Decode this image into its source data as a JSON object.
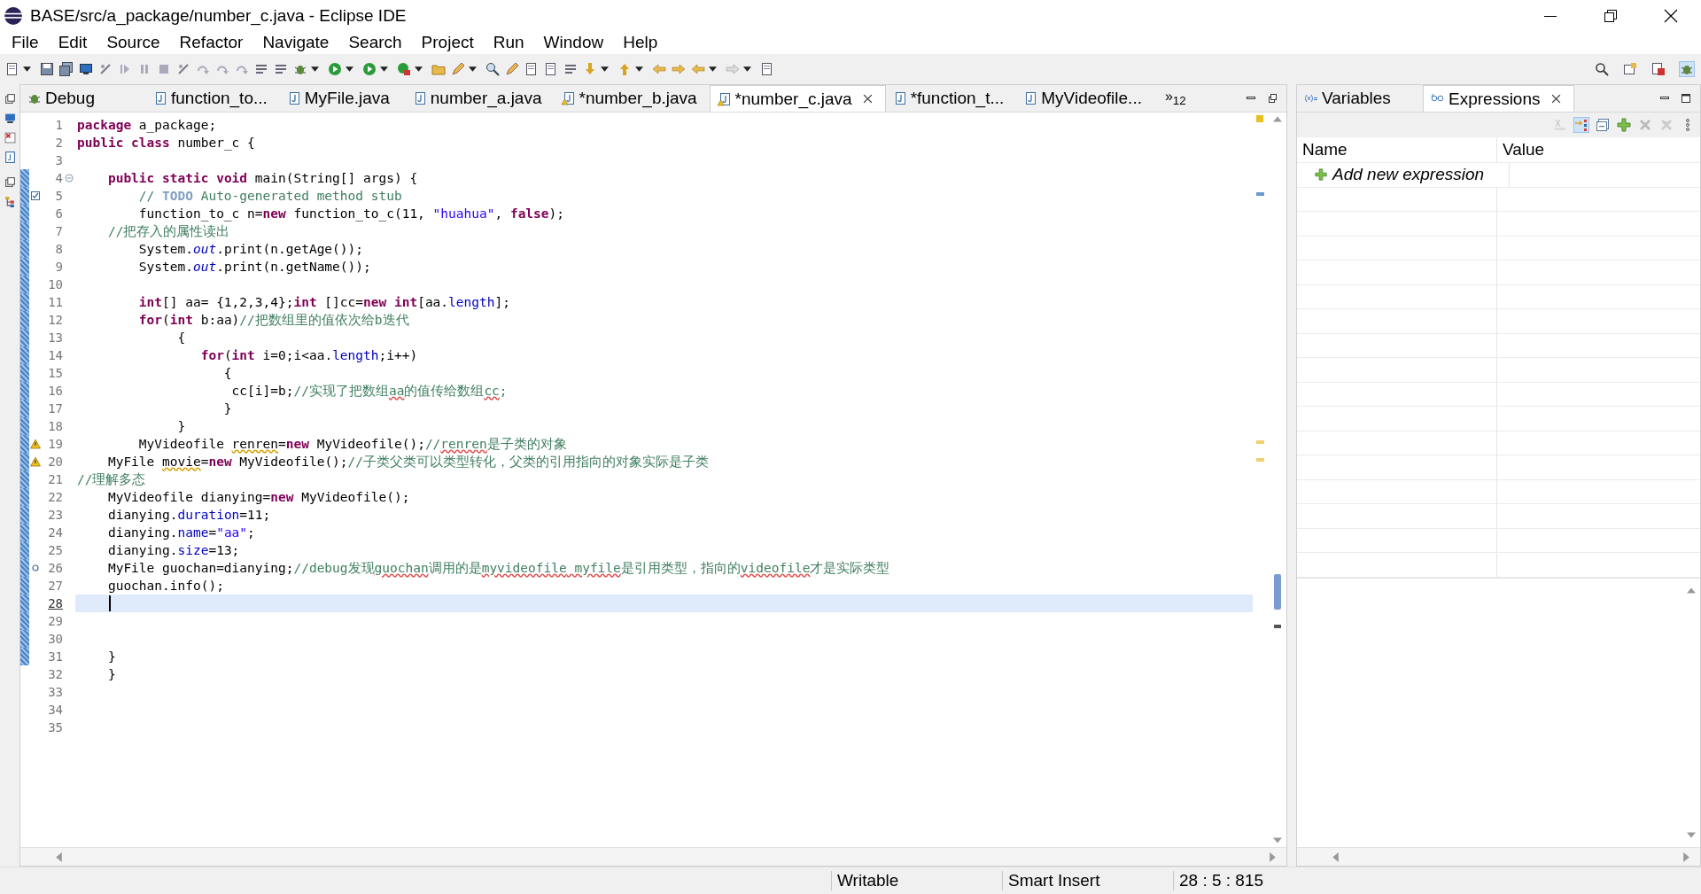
{
  "window": {
    "title": "BASE/src/a_package/number_c.java - Eclipse IDE"
  },
  "menu": [
    "File",
    "Edit",
    "Source",
    "Refactor",
    "Navigate",
    "Search",
    "Project",
    "Run",
    "Window",
    "Help"
  ],
  "editor": {
    "tabs": [
      {
        "label": "Debug",
        "kind": "debug",
        "selected": false
      },
      {
        "label": "function_to...",
        "kind": "java",
        "selected": false
      },
      {
        "label": "MyFile.java",
        "kind": "java",
        "selected": false
      },
      {
        "label": "number_a.java",
        "kind": "java",
        "selected": false
      },
      {
        "label": "*number_b.java",
        "kind": "java-warning",
        "selected": false
      },
      {
        "label": "*number_c.java",
        "kind": "java-warning",
        "selected": true
      },
      {
        "label": "*function_t...",
        "kind": "java",
        "selected": false
      },
      {
        "label": "MyVideofile...",
        "kind": "java",
        "selected": false
      }
    ],
    "tab_overflow": "»$_{12}$",
    "lines": [
      {
        "num": "1",
        "kind": "plain",
        "current": false,
        "changed": false,
        "tokens": [
          {
            "kind": "kw",
            "text": "package"
          },
          {
            "kind": "plain",
            "text": " a_package;"
          }
        ]
      },
      {
        "num": "2",
        "kind": "plain",
        "current": false,
        "changed": false,
        "tokens": [
          {
            "kind": "kw",
            "text": "public"
          },
          {
            "kind": "kw",
            "text": " class"
          },
          {
            "kind": "plain",
            "text": " number_c {"
          }
        ]
      },
      {
        "num": "3",
        "kind": "plain",
        "current": false,
        "changed": false
      },
      {
        "num": "4",
        "kind": "fold",
        "current": false,
        "changed": true,
        "tokens": [
          {
            "kind": "kw",
            "text": "    public"
          },
          {
            "kind": "kw",
            "text": " static"
          },
          {
            "kind": "kw",
            "text": " void"
          },
          {
            "kind": "plain",
            "text": " main(String[] args) {"
          }
        ]
      },
      {
        "num": "5",
        "kind": "task",
        "current": false,
        "changed": true,
        "tokens": [
          {
            "kind": "comment",
            "text": "        // "
          },
          {
            "kind": "todo",
            "text": "TODO"
          },
          {
            "kind": "comment",
            "text": " Auto-generated method stub"
          }
        ]
      },
      {
        "num": "6",
        "kind": "plain",
        "current": false,
        "changed": true,
        "tokens": [
          {
            "kind": "plain",
            "text": "        function_to_c n="
          },
          {
            "kind": "kw",
            "text": "new"
          },
          {
            "kind": "plain",
            "text": " function_to_c(11, "
          },
          {
            "kind": "string",
            "text": "\"huahua\""
          },
          {
            "kind": "plain",
            "text": ", "
          },
          {
            "kind": "kw",
            "text": "false"
          },
          {
            "kind": "plain",
            "text": ");"
          }
        ]
      },
      {
        "num": "7",
        "kind": "plain",
        "current": false,
        "changed": true,
        "tokens": [
          {
            "kind": "comment",
            "text": "    //把存入的属性读出"
          }
        ]
      },
      {
        "num": "8",
        "kind": "plain",
        "current": false,
        "changed": true,
        "tokens": [
          {
            "kind": "plain",
            "text": "        System."
          },
          {
            "kind": "static",
            "text": "out"
          },
          {
            "kind": "plain",
            "text": ".print(n.getAge());"
          }
        ]
      },
      {
        "num": "9",
        "kind": "plain",
        "current": false,
        "changed": true,
        "tokens": [
          {
            "kind": "plain",
            "text": "        System."
          },
          {
            "kind": "static",
            "text": "out"
          },
          {
            "kind": "plain",
            "text": ".print(n.getName());"
          }
        ]
      },
      {
        "num": "10",
        "kind": "plain",
        "current": false,
        "changed": true
      },
      {
        "num": "11",
        "kind": "plain",
        "current": false,
        "changed": true,
        "tokens": [
          {
            "kind": "kw",
            "text": "        int"
          },
          {
            "kind": "plain",
            "text": "[] aa= {1,2,3,4};"
          },
          {
            "kind": "kw",
            "text": "int"
          },
          {
            "kind": "plain",
            "text": " []cc="
          },
          {
            "kind": "kw",
            "text": "new"
          },
          {
            "kind": "kw",
            "text": " int"
          },
          {
            "kind": "plain",
            "text": "[aa."
          },
          {
            "kind": "field",
            "text": "length"
          },
          {
            "kind": "plain",
            "text": "];"
          }
        ]
      },
      {
        "num": "12",
        "kind": "plain",
        "current": false,
        "changed": true,
        "tokens": [
          {
            "kind": "kw",
            "text": "        for"
          },
          {
            "kind": "plain",
            "text": "("
          },
          {
            "kind": "kw",
            "text": "int"
          },
          {
            "kind": "plain",
            "text": " b:aa)"
          },
          {
            "kind": "comment",
            "text": "//把数组里的值依次给b迭代"
          }
        ]
      },
      {
        "num": "13",
        "kind": "plain",
        "current": false,
        "changed": true,
        "tokens": [
          {
            "kind": "plain",
            "text": "             {"
          }
        ]
      },
      {
        "num": "14",
        "kind": "plain",
        "current": false,
        "changed": true,
        "tokens": [
          {
            "kind": "kw",
            "text": "                for"
          },
          {
            "kind": "plain",
            "text": "("
          },
          {
            "kind": "kw",
            "text": "int"
          },
          {
            "kind": "plain",
            "text": " i=0;i<aa."
          },
          {
            "kind": "field",
            "text": "length"
          },
          {
            "kind": "plain",
            "text": ";i++)"
          }
        ]
      },
      {
        "num": "15",
        "kind": "plain",
        "current": false,
        "changed": true,
        "tokens": [
          {
            "kind": "plain",
            "text": "                   {"
          }
        ]
      },
      {
        "num": "16",
        "kind": "plain",
        "current": false,
        "changed": true,
        "tokens": [
          {
            "kind": "plain",
            "text": "                    cc[i]=b;"
          },
          {
            "kind": "comment",
            "text": "//实现了把数组"
          },
          {
            "kind": "comment-spell",
            "text": "aa"
          },
          {
            "kind": "comment",
            "text": "的值传给数组"
          },
          {
            "kind": "comment-spell",
            "text": "cc"
          },
          {
            "kind": "comment",
            "text": ";"
          }
        ]
      },
      {
        "num": "17",
        "kind": "plain",
        "current": false,
        "changed": true,
        "tokens": [
          {
            "kind": "plain",
            "text": "                   }"
          }
        ]
      },
      {
        "num": "18",
        "kind": "plain",
        "current": false,
        "changed": true,
        "tokens": [
          {
            "kind": "plain",
            "text": "             }"
          }
        ]
      },
      {
        "num": "19",
        "kind": "warning",
        "current": false,
        "changed": true,
        "tokens": [
          {
            "kind": "plain",
            "text": "        MyVideofile "
          },
          {
            "kind": "warn",
            "text": "renren"
          },
          {
            "kind": "plain",
            "text": "="
          },
          {
            "kind": "kw",
            "text": "new"
          },
          {
            "kind": "plain",
            "text": " MyVideofile();"
          },
          {
            "kind": "comment",
            "text": "//"
          },
          {
            "kind": "comment-spell",
            "text": "renren"
          },
          {
            "kind": "comment",
            "text": "是子类的对象"
          }
        ]
      },
      {
        "num": "20",
        "kind": "warning",
        "current": false,
        "changed": true,
        "tokens": [
          {
            "kind": "plain",
            "text": "    MyFile "
          },
          {
            "kind": "warn",
            "text": "movie"
          },
          {
            "kind": "plain",
            "text": "="
          },
          {
            "kind": "kw",
            "text": "new"
          },
          {
            "kind": "plain",
            "text": " MyVideofile();"
          },
          {
            "kind": "comment",
            "text": "//子类父类可以类型转化，父类的引用指向的对象实际是子类"
          }
        ]
      },
      {
        "num": "21",
        "kind": "plain",
        "current": false,
        "changed": true,
        "tokens": [
          {
            "kind": "comment",
            "text": "//理解多态"
          }
        ]
      },
      {
        "num": "22",
        "kind": "plain",
        "current": false,
        "changed": true,
        "tokens": [
          {
            "kind": "plain",
            "text": "    MyVideofile dianying="
          },
          {
            "kind": "kw",
            "text": "new"
          },
          {
            "kind": "plain",
            "text": " MyVideofile();"
          }
        ]
      },
      {
        "num": "23",
        "kind": "plain",
        "current": false,
        "changed": true,
        "tokens": [
          {
            "kind": "plain",
            "text": "    dianying."
          },
          {
            "kind": "field",
            "text": "duration"
          },
          {
            "kind": "plain",
            "text": "=11;"
          }
        ]
      },
      {
        "num": "24",
        "kind": "plain",
        "current": false,
        "changed": true,
        "tokens": [
          {
            "kind": "plain",
            "text": "    dianying."
          },
          {
            "kind": "field",
            "text": "name"
          },
          {
            "kind": "plain",
            "text": "="
          },
          {
            "kind": "string",
            "text": "\"aa\""
          },
          {
            "kind": "plain",
            "text": ";"
          }
        ]
      },
      {
        "num": "25",
        "kind": "plain",
        "current": false,
        "changed": true,
        "tokens": [
          {
            "kind": "plain",
            "text": "    dianying."
          },
          {
            "kind": "field",
            "text": "size"
          },
          {
            "kind": "plain",
            "text": "=13;"
          }
        ]
      },
      {
        "num": "26",
        "kind": "breakpoint",
        "current": false,
        "changed": true,
        "tokens": [
          {
            "kind": "plain",
            "text": "    MyFile guochan=dianying;"
          },
          {
            "kind": "comment",
            "text": "//debug发现"
          },
          {
            "kind": "comment-spell",
            "text": "guochan"
          },
          {
            "kind": "comment",
            "text": "调用的是"
          },
          {
            "kind": "comment-spell",
            "text": "myvideofile"
          },
          {
            "kind": "comment-spell",
            "text": " myfile"
          },
          {
            "kind": "comment",
            "text": "是引用类型，指向的"
          },
          {
            "kind": "comment-spell",
            "text": "videofile"
          },
          {
            "kind": "comment",
            "text": "才是实际类型"
          }
        ]
      },
      {
        "num": "27",
        "kind": "plain",
        "current": false,
        "changed": true,
        "tokens": [
          {
            "kind": "plain",
            "text": "    guochan.info();"
          }
        ]
      },
      {
        "num": "28",
        "kind": "plain",
        "current": true,
        "changed": true
      },
      {
        "num": "29",
        "kind": "plain",
        "current": false,
        "changed": true
      },
      {
        "num": "30",
        "kind": "plain",
        "current": false,
        "changed": true
      },
      {
        "num": "31",
        "kind": "plain",
        "current": false,
        "changed": true,
        "tokens": [
          {
            "kind": "plain",
            "text": "    }"
          }
        ]
      },
      {
        "num": "32",
        "kind": "plain",
        "current": false,
        "changed": false,
        "tokens": [
          {
            "kind": "plain",
            "text": "    }"
          }
        ]
      },
      {
        "num": "33",
        "kind": "plain",
        "current": false,
        "changed": false
      },
      {
        "num": "34",
        "kind": "plain",
        "current": false,
        "changed": false
      },
      {
        "num": "35",
        "kind": "plain",
        "current": false,
        "changed": false
      }
    ]
  },
  "expressions": {
    "tabs": [
      {
        "label": "Variables",
        "kind": "variables",
        "selected": false
      },
      {
        "label": "Expressions",
        "kind": "expressions",
        "selected": true
      }
    ],
    "columns": [
      "Name",
      "Value"
    ],
    "add_row": "Add new expression"
  },
  "status_bar": [
    "Writable",
    "Smart Insert",
    "28 : 5 : 815"
  ]
}
